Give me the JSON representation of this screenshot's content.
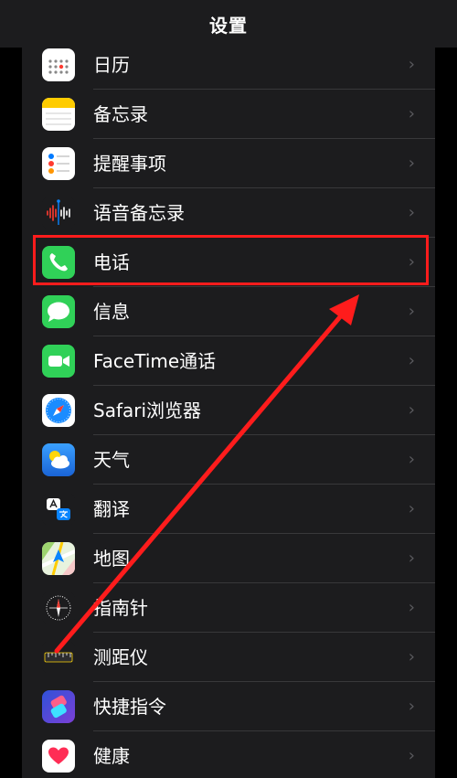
{
  "header": {
    "title": "设置"
  },
  "rows": [
    {
      "label": "日历",
      "icon": "calendar-icon"
    },
    {
      "label": "备忘录",
      "icon": "notes-icon"
    },
    {
      "label": "提醒事项",
      "icon": "reminders-icon"
    },
    {
      "label": "语音备忘录",
      "icon": "voice-memos-icon"
    },
    {
      "label": "电话",
      "icon": "phone-icon"
    },
    {
      "label": "信息",
      "icon": "messages-icon"
    },
    {
      "label": "FaceTime通话",
      "icon": "facetime-icon"
    },
    {
      "label": "Safari浏览器",
      "icon": "safari-icon"
    },
    {
      "label": "天气",
      "icon": "weather-icon"
    },
    {
      "label": "翻译",
      "icon": "translate-icon"
    },
    {
      "label": "地图",
      "icon": "maps-icon"
    },
    {
      "label": "指南针",
      "icon": "compass-icon"
    },
    {
      "label": "测距仪",
      "icon": "measure-icon"
    },
    {
      "label": "快捷指令",
      "icon": "shortcuts-icon"
    },
    {
      "label": "健康",
      "icon": "health-icon"
    }
  ],
  "chevron": "›",
  "colors": {
    "background": "#000000",
    "group": "#1c1c1e",
    "separator": "#38383a",
    "annotation": "#ff1c1c"
  }
}
